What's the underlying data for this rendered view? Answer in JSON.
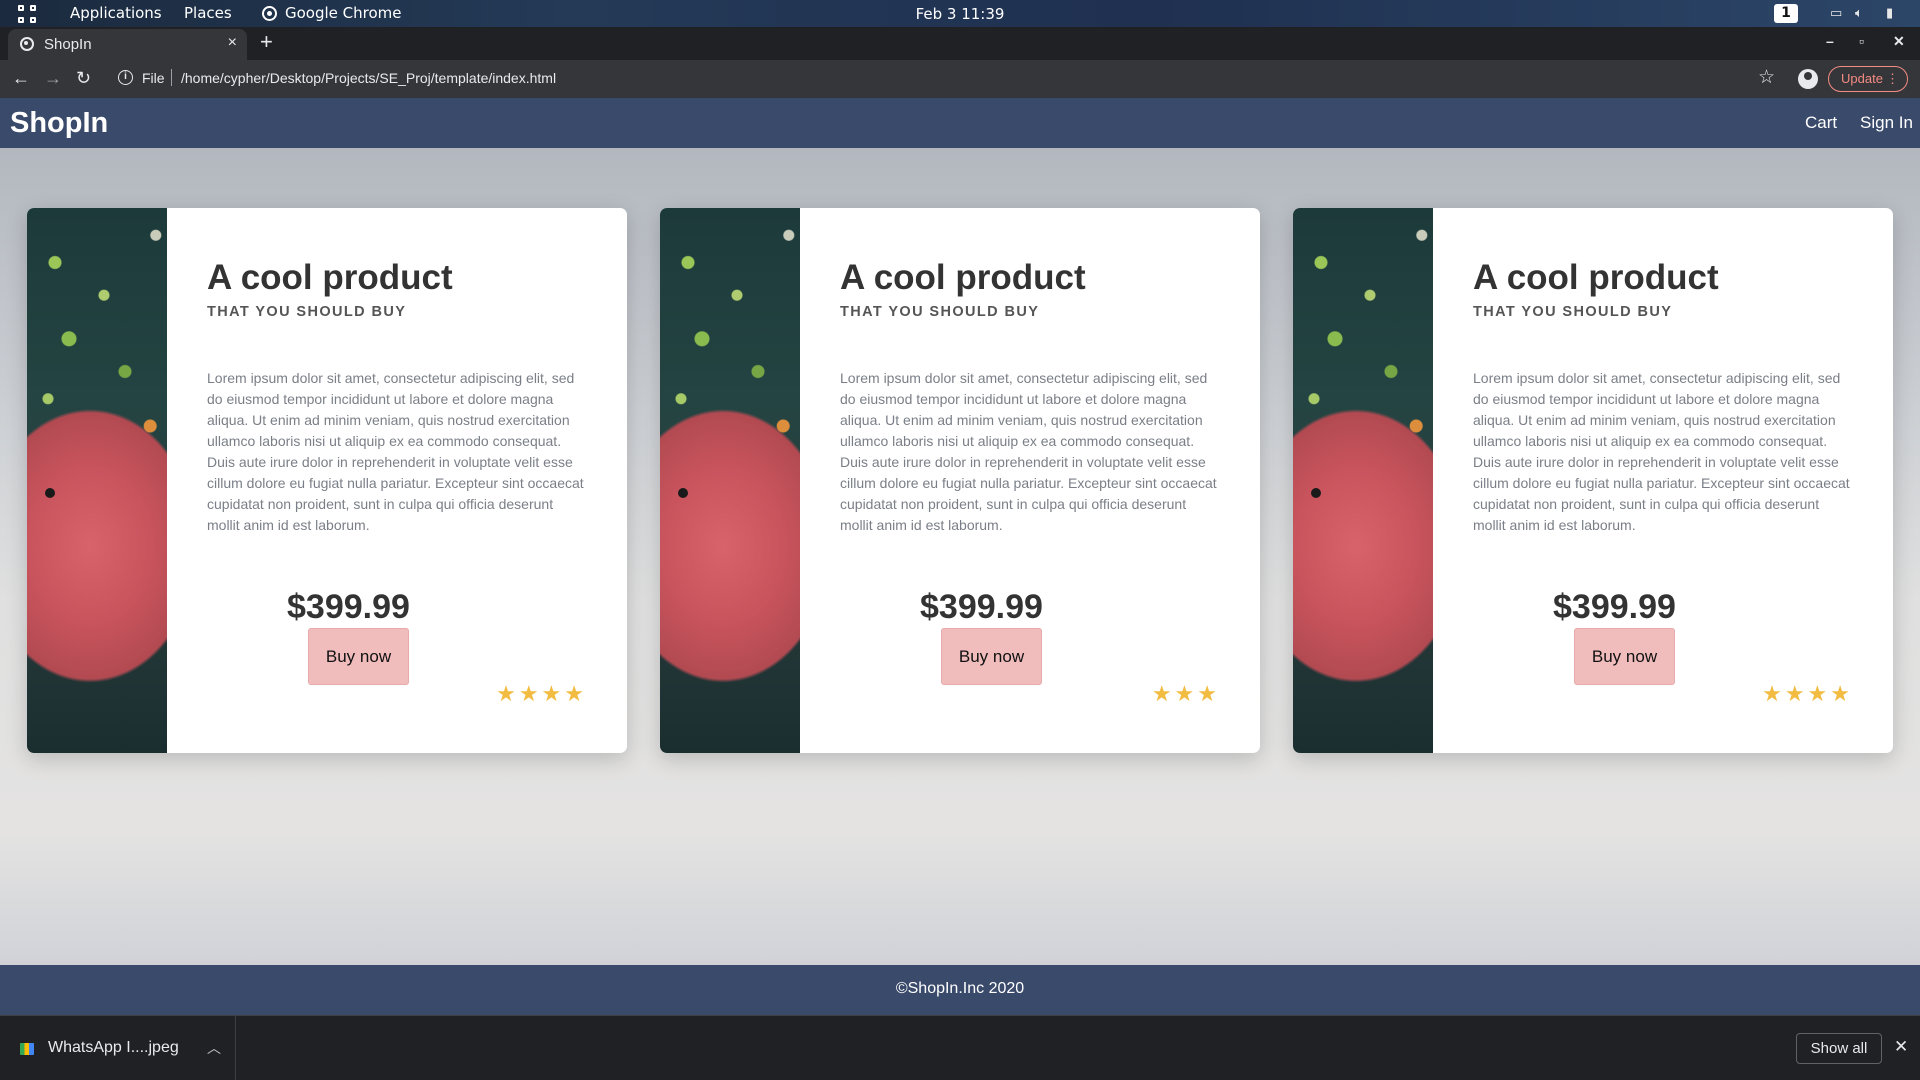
{
  "topbar": {
    "applications": "Applications",
    "places": "Places",
    "browser_name": "Google Chrome",
    "clock": "Feb 3  11:39",
    "workspace": "1",
    "icons": [
      "apps-grid-icon",
      "chrome-icon",
      "display-icon",
      "volume-icon",
      "battery-icon"
    ]
  },
  "browser": {
    "tab_title": "ShopIn",
    "tab_close": "×",
    "new_tab": "+",
    "window_controls": {
      "minimize": "–",
      "maximize": "▫",
      "close": "✕"
    },
    "url_scheme": "File",
    "url": "/home/cypher/Desktop/Projects/SE_Proj/template/index.html",
    "update_label": "Update",
    "update_menu": "⋮"
  },
  "site": {
    "brand": "ShopIn",
    "nav": {
      "cart": "Cart",
      "sign_in": "Sign In"
    },
    "products": [
      {
        "title": "A cool product",
        "subtitle": "THAT YOU SHOULD BUY",
        "description": "Lorem ipsum dolor sit amet, consectetur adipiscing elit, sed do eiusmod tempor incididunt ut labore et dolore magna aliqua. Ut enim ad minim veniam, quis nostrud exercitation ullamco laboris nisi ut aliquip ex ea commodo consequat. Duis aute irure dolor in reprehenderit in voluptate velit esse cillum dolore eu fugiat nulla pariatur. Excepteur sint occaecat cupidatat non proident, sunt in culpa qui officia deserunt mollit anim id est laborum.",
        "price": "$399.99",
        "buy_label": "Buy now",
        "rating_stars": 4,
        "stars": "★★★★"
      },
      {
        "title": "A cool product",
        "subtitle": "THAT YOU SHOULD BUY",
        "description": "Lorem ipsum dolor sit amet, consectetur adipiscing elit, sed do eiusmod tempor incididunt ut labore et dolore magna aliqua. Ut enim ad minim veniam, quis nostrud exercitation ullamco laboris nisi ut aliquip ex ea commodo consequat. Duis aute irure dolor in reprehenderit in voluptate velit esse cillum dolore eu fugiat nulla pariatur. Excepteur sint occaecat cupidatat non proident, sunt in culpa qui officia deserunt mollit anim id est laborum.",
        "price": "$399.99",
        "buy_label": "Buy now",
        "rating_stars": 3,
        "stars": "★★★"
      },
      {
        "title": "A cool product",
        "subtitle": "THAT YOU SHOULD BUY",
        "description": "Lorem ipsum dolor sit amet, consectetur adipiscing elit, sed do eiusmod tempor incididunt ut labore et dolore magna aliqua. Ut enim ad minim veniam, quis nostrud exercitation ullamco laboris nisi ut aliquip ex ea commodo consequat. Duis aute irure dolor in reprehenderit in voluptate velit esse cillum dolore eu fugiat nulla pariatur. Excepteur sint occaecat cupidatat non proident, sunt in culpa qui officia deserunt mollit anim id est laborum.",
        "price": "$399.99",
        "buy_label": "Buy now",
        "rating_stars": 4,
        "stars": "★★★★"
      }
    ],
    "footer": "©ShopIn.Inc 2020"
  },
  "downloads": {
    "file_name": "WhatsApp I....jpeg",
    "show_all": "Show all",
    "close": "✕"
  },
  "colors": {
    "header_bg": "#3a4a6b",
    "buy_button": "#f0bcbc",
    "star": "#f2bc42",
    "update_accent": "#f28b82"
  }
}
